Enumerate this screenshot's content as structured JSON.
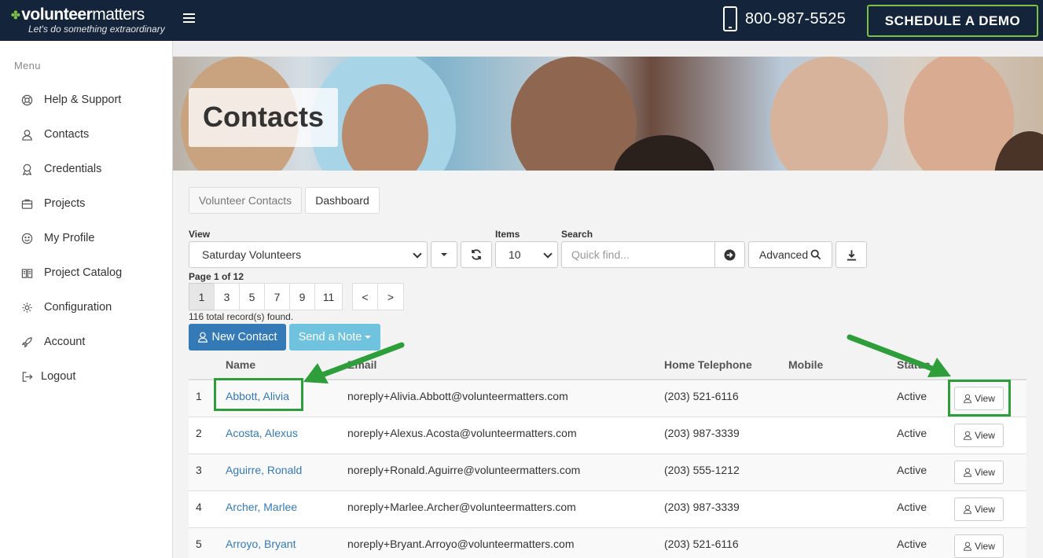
{
  "header": {
    "logo_bold": "volunteer",
    "logo_light": "matters",
    "tagline": "Let's do something extraordinary",
    "phone": "800-987-5525",
    "demo_button": "SCHEDULE A DEMO"
  },
  "sidebar": {
    "title": "Menu",
    "items": [
      {
        "label": "Help & Support",
        "icon": "support-icon"
      },
      {
        "label": "Contacts",
        "icon": "contacts-icon"
      },
      {
        "label": "Credentials",
        "icon": "credentials-icon"
      },
      {
        "label": "Projects",
        "icon": "projects-icon"
      },
      {
        "label": "My Profile",
        "icon": "smiley-icon"
      },
      {
        "label": "Project Catalog",
        "icon": "catalog-icon"
      },
      {
        "label": "Configuration",
        "icon": "gear-icon"
      },
      {
        "label": "Account",
        "icon": "rocket-icon"
      },
      {
        "label": "Logout",
        "icon": "logout-icon"
      }
    ]
  },
  "banner": {
    "title": "Contacts"
  },
  "tabs": {
    "volunteer_contacts": "Volunteer Contacts",
    "dashboard": "Dashboard"
  },
  "controls": {
    "view_label": "View",
    "view_value": "Saturday Volunteers",
    "items_label": "Items",
    "items_value": "10",
    "search_label": "Search",
    "search_placeholder": "Quick find...",
    "advanced_label": "Advanced"
  },
  "pagination": {
    "page_info": "Page 1 of 12",
    "pages": [
      "1",
      "3",
      "5",
      "7",
      "9",
      "11"
    ],
    "prev": "<",
    "next": ">",
    "records": "116 total record(s) found."
  },
  "actions": {
    "new_contact": "New Contact",
    "send_note": "Send a Note"
  },
  "table": {
    "columns": {
      "name": "Name",
      "email": "Email",
      "home_telephone": "Home Telephone",
      "mobile": "Mobile",
      "status": "Status"
    },
    "view_label": "View",
    "rows": [
      {
        "num": "1",
        "name": "Abbott, Alivia",
        "email": "noreply+Alivia.Abbott@volunteermatters.com",
        "phone": "(203) 521-6116",
        "mobile": "",
        "status": "Active"
      },
      {
        "num": "2",
        "name": "Acosta, Alexus",
        "email": "noreply+Alexus.Acosta@volunteermatters.com",
        "phone": "(203) 987-3339",
        "mobile": "",
        "status": "Active"
      },
      {
        "num": "3",
        "name": "Aguirre, Ronald",
        "email": "noreply+Ronald.Aguirre@volunteermatters.com",
        "phone": "(203) 555-1212",
        "mobile": "",
        "status": "Active"
      },
      {
        "num": "4",
        "name": "Archer, Marlee",
        "email": "noreply+Marlee.Archer@volunteermatters.com",
        "phone": "(203) 987-3339",
        "mobile": "",
        "status": "Active"
      },
      {
        "num": "5",
        "name": "Arroyo, Bryant",
        "email": "noreply+Bryant.Arroyo@volunteermatters.com",
        "phone": "(203) 521-6116",
        "mobile": "",
        "status": "Active"
      }
    ]
  },
  "colors": {
    "topbar": "#13243b",
    "brand_green": "#7bc143",
    "primary": "#337ab7",
    "info": "#6fc3de",
    "annotation": "#2e9e3a"
  }
}
